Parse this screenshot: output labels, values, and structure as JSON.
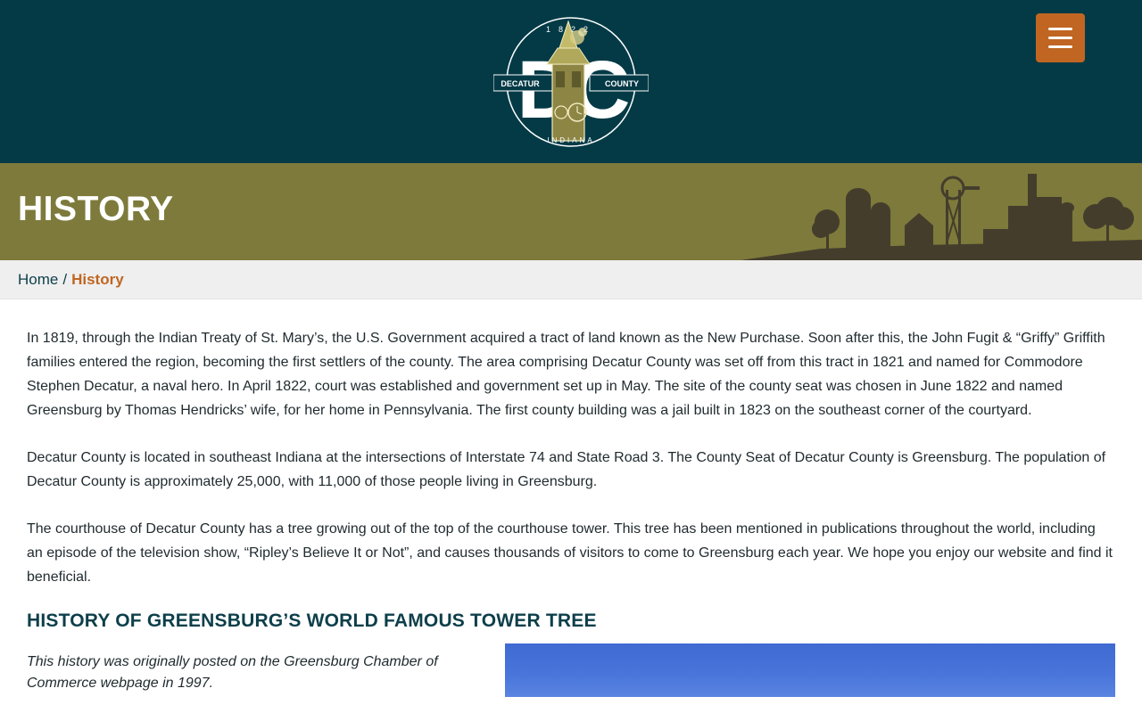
{
  "header": {
    "logo": {
      "year": "1822",
      "initials": "DC",
      "left_word": "DECATUR",
      "right_word": "COUNTY",
      "state": "INDIANA"
    },
    "menu_icon": "hamburger-icon"
  },
  "banner": {
    "title": "HISTORY"
  },
  "breadcrumb": {
    "home": "Home",
    "separator": "/",
    "current": "History"
  },
  "content": {
    "paragraphs": [
      "In 1819, through the Indian Treaty of St. Mary’s, the U.S. Government acquired a tract of land known as the New Purchase. Soon after this, the John Fugit & “Griffy” Griffith families entered the region, becoming the first settlers of the county. The area comprising Decatur County was set off from this tract in 1821 and named for Commodore Stephen Decatur, a naval hero. In April 1822, court was established and government set up in May. The site of the county seat was chosen in June 1822 and named Greensburg by Thomas Hendricks’ wife, for her home in Pennsylvania. The first county building was a jail built in 1823 on the southeast corner of the courtyard.",
      "Decatur County is located in southeast Indiana at the intersections of Interstate 74 and State Road 3. The County Seat of Decatur County is Greensburg. The population of Decatur County is approximately 25,000, with 11,000 of those people living in Greensburg.",
      "The courthouse of Decatur County has a tree growing out of the top of the courthouse tower. This tree has been mentioned in publications throughout the world, including an episode of the television show, “Ripley’s Believe It or Not”, and causes thousands of visitors to come to Greensburg each year. We hope you enjoy our website and find it beneficial."
    ],
    "heading": "HISTORY OF GREENSBURG’S WORLD FAMOUS TOWER TREE",
    "note": "This history was originally posted on the Greensburg Chamber of Commerce webpage in 1997."
  },
  "colors": {
    "header_bg": "#033a46",
    "banner_bg": "#7d7a3b",
    "accent": "#c06622",
    "heading": "#0d3f4a",
    "breadcrumb_bg": "#efefef"
  }
}
